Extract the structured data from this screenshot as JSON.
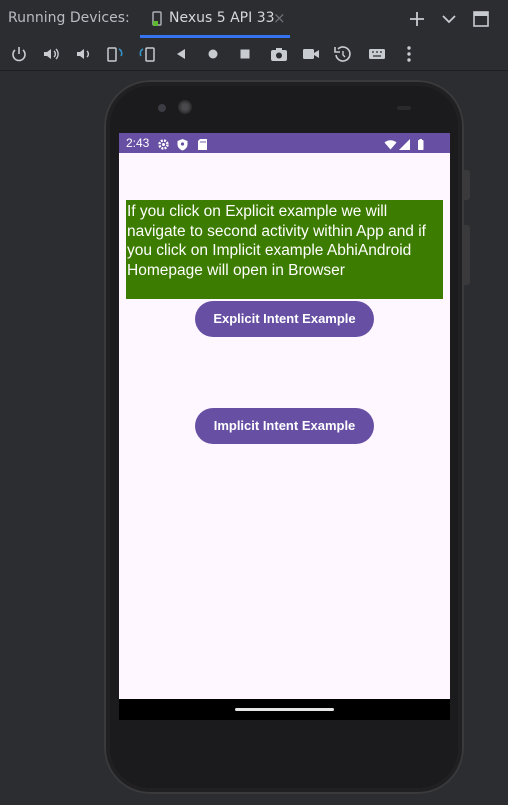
{
  "panel": {
    "title": "Running Devices:",
    "tab": {
      "label": "Nexus 5 API 33",
      "close": "×"
    }
  },
  "toolbar": {
    "buttons": [
      "power-icon",
      "volume-up-icon",
      "volume-down-icon",
      "rotate-left-icon",
      "rotate-right-icon",
      "back-icon",
      "home-icon",
      "overview-icon",
      "screenshot-icon",
      "screen-record-icon",
      "reset-icon",
      "keyboard-icon",
      "more-icon"
    ]
  },
  "device": {
    "status_bar": {
      "time": "2:43",
      "color": "#6750a4"
    },
    "info_text": "If you click on Explicit example we will navigate to second activity within App and if you click on Implicit example AbhiAndroid Homepage will open in Browser",
    "info_bg": "#3c7c00",
    "explicit_button": "Explicit Intent Example",
    "implicit_button": "Implicit Intent Example",
    "accent": "#6750a4"
  }
}
